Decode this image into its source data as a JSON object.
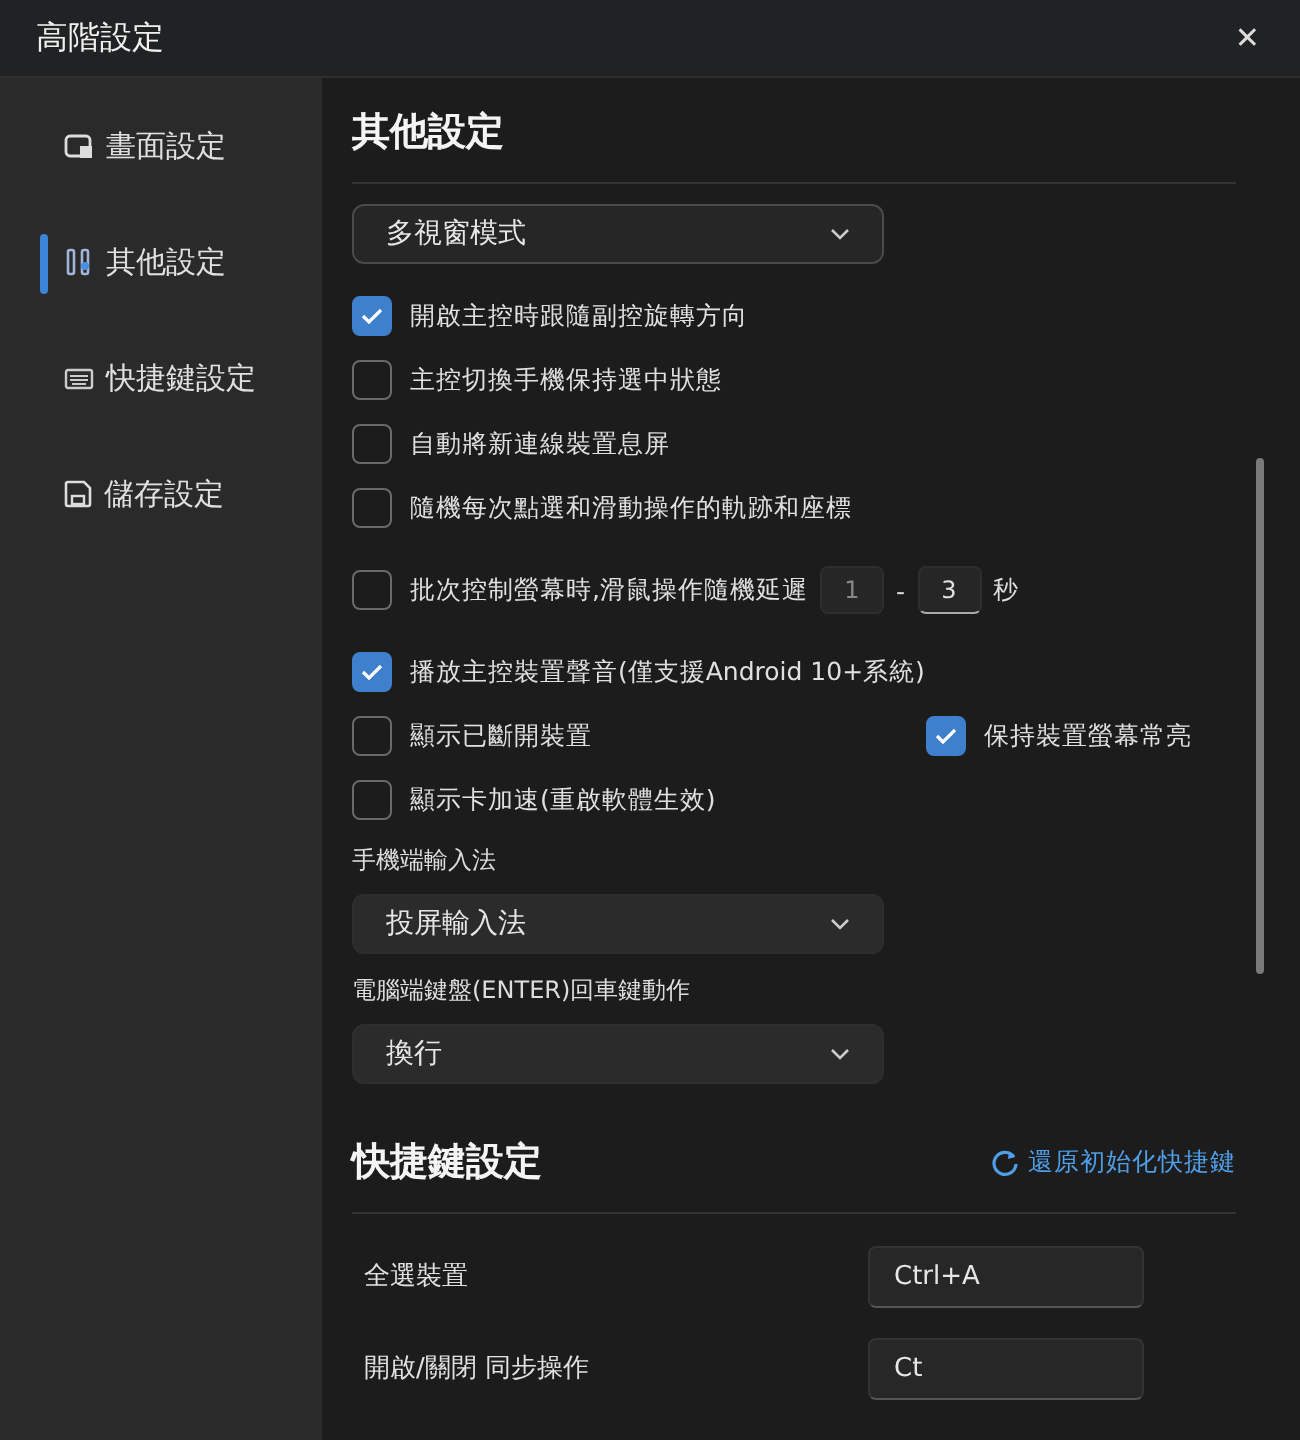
{
  "window": {
    "title": "高階設定",
    "close": "✕"
  },
  "sidebar": {
    "items": [
      {
        "label": "畫面設定",
        "selected": false
      },
      {
        "label": "其他設定",
        "selected": true
      },
      {
        "label": "快捷鍵設定",
        "selected": false
      },
      {
        "label": "儲存設定",
        "selected": false
      }
    ]
  },
  "other": {
    "title": "其他設定",
    "mode_select": {
      "value": "多視窗模式"
    },
    "options": [
      {
        "label": "開啟主控時跟隨副控旋轉方向",
        "checked": true
      },
      {
        "label": "主控切換手機保持選中狀態",
        "checked": false
      },
      {
        "label": "自動將新連線裝置息屏",
        "checked": false
      },
      {
        "label": "隨機每次點選和滑動操作的軌跡和座標",
        "checked": false
      },
      {
        "label": "批次控制螢幕時,滑鼠操作隨機延遲",
        "checked": false,
        "delay": {
          "from": {
            "value": "1",
            "focused": false
          },
          "separator": "-",
          "to": {
            "value": "3",
            "focused": true
          },
          "unit": "秒"
        }
      },
      {
        "label": "播放主控裝置聲音(僅支援Android 10+系統)",
        "checked": true
      },
      {
        "label": "顯示已斷開裝置",
        "checked": false,
        "side": {
          "label": "保持裝置螢幕常亮",
          "checked": true
        }
      },
      {
        "label": "顯示卡加速(重啟軟體生效)",
        "checked": false
      }
    ],
    "selects": [
      {
        "label": "手機端輸入法",
        "value": "投屏輸入法"
      },
      {
        "label": "電腦端鍵盤(ENTER)回車鍵動作",
        "value": "換行"
      }
    ]
  },
  "shortcuts": {
    "title": "快捷鍵設定",
    "reset": "還原初始化快捷鍵",
    "rows": [
      {
        "label": "全選裝置",
        "value": "Ctrl+A"
      },
      {
        "label": "開啟/關閉 同步操作",
        "value": "Ct"
      }
    ]
  }
}
